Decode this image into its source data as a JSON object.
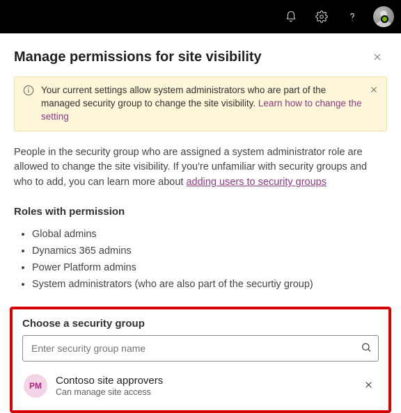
{
  "topbar": {
    "icons": [
      "bell",
      "gear",
      "question",
      "avatar"
    ]
  },
  "panel": {
    "title": "Manage permissions for site visibility"
  },
  "banner": {
    "text": "Your current settings allow system administrators who are part of the managed security group to change the site visibility. ",
    "link_text": "Learn how to change the setting"
  },
  "body": {
    "text_before_link": "People in the security group who are assigned a system administrator role are allowed to change the site visibility. If you're unfamiliar with security groups and who to add, you can learn more about ",
    "link_text": "adding users to security groups"
  },
  "roles": {
    "heading": "Roles with permission",
    "items": [
      "Global admins",
      "Dynamics 365 admins",
      "Power Platform admins",
      "System administrators (who are also part of the securtiy group)"
    ]
  },
  "search": {
    "heading": "Choose a security group",
    "placeholder": "Enter security group name"
  },
  "group": {
    "initials": "PM",
    "name": "Contoso site approvers",
    "subtitle": "Can manage site access"
  }
}
